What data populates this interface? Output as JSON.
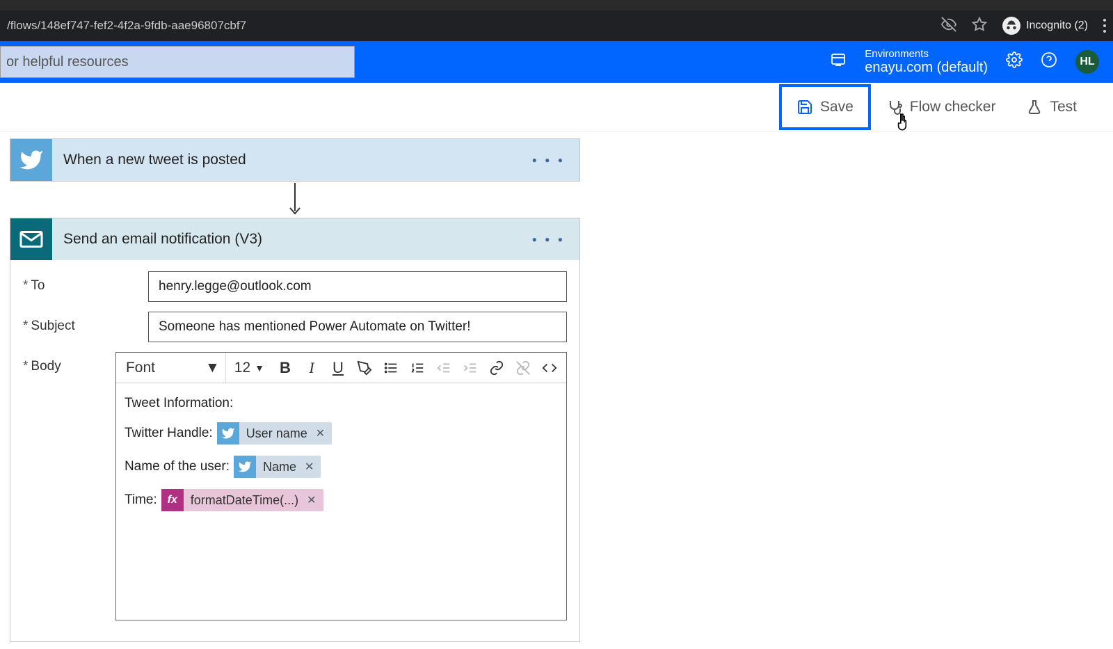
{
  "browser": {
    "url": "/flows/148ef747-fef2-4f2a-9fdb-aae96807cbf7",
    "incognito_label": "Incognito (2)"
  },
  "header": {
    "search_placeholder": "or helpful resources",
    "env_label": "Environments",
    "env_name": "enayu.com (default)",
    "avatar_initials": "HL"
  },
  "toolbar": {
    "save_label": "Save",
    "checker_label": "Flow checker",
    "test_label": "Test"
  },
  "trigger": {
    "title": "When a new tweet is posted"
  },
  "action": {
    "title": "Send an email notification (V3)",
    "to_label": "To",
    "to_value": "henry.legge@outlook.com",
    "subject_label": "Subject",
    "subject_value": "Someone has mentioned Power Automate on Twitter!",
    "body_label": "Body",
    "rte": {
      "font_label": "Font",
      "size_label": "12"
    },
    "body": {
      "heading": "Tweet Information:",
      "line1_label": "Twitter Handle:",
      "token1": "User name",
      "line2_label": "Name of the user:",
      "token2": "Name",
      "line3_label": "Time:",
      "token3": "formatDateTime(...)"
    }
  }
}
